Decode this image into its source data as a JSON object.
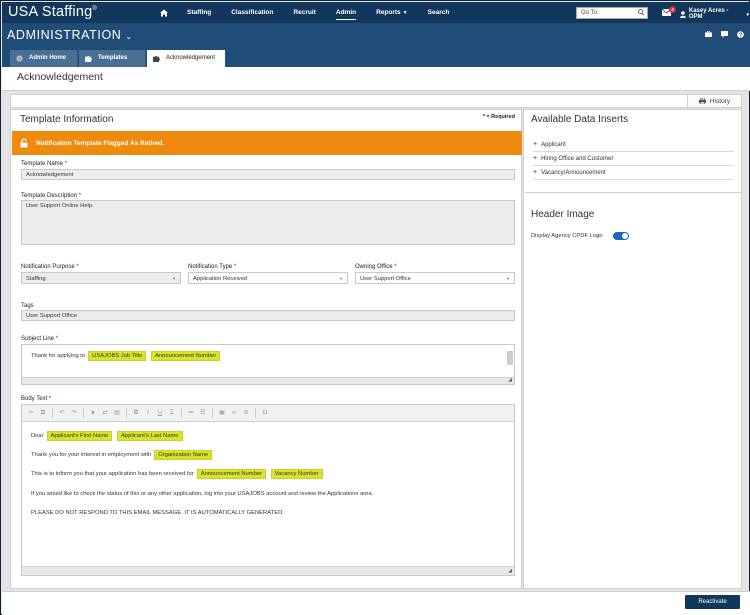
{
  "app": {
    "logo": "USA Staffing",
    "logo_mark": "®",
    "nav": [
      "Staffing",
      "Classification",
      "Recruit",
      "Admin",
      "Reports",
      "Search"
    ],
    "goto_placeholder": "Go To",
    "mail_badge": "4",
    "user": "Kasey Acres - OPM"
  },
  "admin": {
    "title": "ADMINISTRATION"
  },
  "tabs": [
    {
      "label": "Admin Home"
    },
    {
      "label": "Templates"
    },
    {
      "label": "Acknowledgement"
    }
  ],
  "page": {
    "title": "Acknowledgement",
    "history_label": "History"
  },
  "template_info": {
    "title": "Template Information",
    "required_note": "* = Required",
    "flag_message": "Notification Template Flagged As Retired.",
    "name_label": "Template Name",
    "name_value": "Acknowledgement",
    "desc_label": "Template Description",
    "desc_value": "User Support Online Help",
    "purpose_label": "Notification Purpose",
    "purpose_value": "Staffing",
    "type_label": "Notification Type",
    "type_value": "Application Received",
    "office_label": "Owning Office",
    "office_value": "User Support Office",
    "tags_label": "Tags",
    "tags_value": "User Support Office",
    "subject_label": "Subject Line",
    "subject_text": "Thank for applying to",
    "subject_ins1": "USAJOBS Job Title",
    "subject_ins2": "Announcement Number",
    "body_label": "Body Text",
    "body": {
      "dear": "Dear",
      "first_name": "Applicant's First Name",
      "last_name": "Applicant's Last Name",
      "interest": "Thank you for your interest in employment with",
      "org": "Organization Name",
      "received": "This is to inform you that your application has been received for",
      "ann_num": "Announcement Number",
      "vac_num": "Vacancy Number",
      "status": "If you would like to check the status of this or any other application, log into your USAJOBS account and review the Applications area.",
      "noreply": "PLEASE DO NOT RESPOND TO THIS EMAIL MESSAGE. IT IS AUTOMATICALLY GENERATED."
    }
  },
  "inserts": {
    "title": "Available Data Inserts",
    "items": [
      "Applicant",
      "Hiring Office and Customer",
      "Vacancy/Announcement"
    ]
  },
  "header_image": {
    "title": "Header Image",
    "logo_label": "Display Agency CPDF Logo",
    "logo_on": true
  },
  "footer": {
    "reactivate_label": "Reactivate"
  },
  "colors": {
    "nav": "#11385c",
    "admin": "#1f4d78",
    "flag": "#ee8a0e",
    "insert": "#d6e52a",
    "toggle": "#1a69b8"
  }
}
